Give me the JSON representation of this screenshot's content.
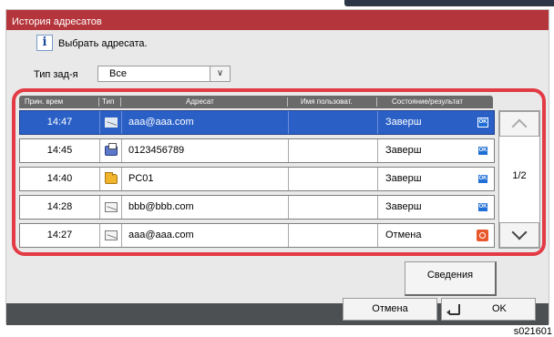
{
  "window": {
    "title": "История адресатов"
  },
  "info": {
    "icon": "info-icon",
    "text": "Выбрать адресата."
  },
  "filter": {
    "label": "Тип зад-я",
    "value": "Все"
  },
  "table": {
    "columns": [
      "Прин. врем",
      "Тип",
      "Адресат",
      "Имя пользоват.",
      "Состояние/результат"
    ],
    "rows": [
      {
        "time": "14:47",
        "type_icon": "email-icon",
        "address": "aaa@aaa.com",
        "user": "",
        "status": "Заверш",
        "result_icon": "ok-icon"
      },
      {
        "time": "14:45",
        "type_icon": "fax-icon",
        "address": "0123456789",
        "user": "",
        "status": "Заверш",
        "result_icon": "ok-icon"
      },
      {
        "time": "14:40",
        "type_icon": "folder-icon",
        "address": "PC01",
        "user": "",
        "status": "Заверш",
        "result_icon": "ok-icon"
      },
      {
        "time": "14:28",
        "type_icon": "email-icon",
        "address": "bbb@bbb.com",
        "user": "",
        "status": "Заверш",
        "result_icon": "ok-icon"
      },
      {
        "time": "14:27",
        "type_icon": "email-icon",
        "address": "aaa@aaa.com",
        "user": "",
        "status": "Отмена",
        "result_icon": "error-icon"
      }
    ]
  },
  "pager": {
    "indicator": "1/2"
  },
  "buttons": {
    "details": "Сведения",
    "cancel": "Отмена",
    "ok": "OK"
  },
  "footer": {
    "code": "s021601"
  },
  "colors": {
    "title_bar": "#b5353c",
    "highlight_frame": "#e33b45",
    "selected_row": "#2a60c6",
    "ok_badge": "#1f6fd6",
    "error_badge": "#e8582a"
  }
}
